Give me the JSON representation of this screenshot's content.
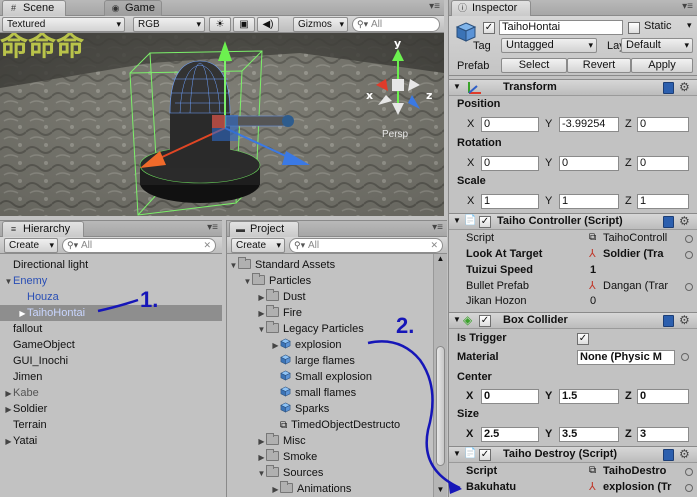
{
  "scene": {
    "tab_scene": "Scene",
    "tab_game": "Game",
    "draw_mode": "Textured",
    "color_mode": "RGB",
    "gizmos": "Gizmos",
    "search_placeholder": "All",
    "persp_label": "Persp",
    "axis_x": "x",
    "axis_y": "y",
    "axis_z": "z",
    "overlay_text": "命命命"
  },
  "hierarchy": {
    "title": "Hierarchy",
    "create": "Create",
    "search_placeholder": "All",
    "items": [
      {
        "label": "Directional light",
        "indent": 0,
        "arrow": "",
        "style": "normal"
      },
      {
        "label": "Enemy",
        "indent": 0,
        "arrow": "▼",
        "style": "blue"
      },
      {
        "label": "Houza",
        "indent": 1,
        "arrow": "",
        "style": "blue"
      },
      {
        "label": "TaihoHontai",
        "indent": 1,
        "arrow": "▶",
        "style": "selected"
      },
      {
        "label": "fallout",
        "indent": 0,
        "arrow": "",
        "style": "normal"
      },
      {
        "label": "GameObject",
        "indent": 0,
        "arrow": "",
        "style": "normal"
      },
      {
        "label": "GUI_Inochi",
        "indent": 0,
        "arrow": "",
        "style": "normal"
      },
      {
        "label": "Jimen",
        "indent": 0,
        "arrow": "",
        "style": "normal"
      },
      {
        "label": "Kabe",
        "indent": 0,
        "arrow": "▶",
        "style": "gray"
      },
      {
        "label": "Soldier",
        "indent": 0,
        "arrow": "▶",
        "style": "normal"
      },
      {
        "label": "Terrain",
        "indent": 0,
        "arrow": "",
        "style": "normal"
      },
      {
        "label": "Yatai",
        "indent": 0,
        "arrow": "▶",
        "style": "normal"
      }
    ]
  },
  "project": {
    "title": "Project",
    "create": "Create",
    "search_placeholder": "All",
    "items": [
      {
        "label": "Standard Assets",
        "indent": 0,
        "arrow": "▼",
        "icon": "folder"
      },
      {
        "label": "Particles",
        "indent": 1,
        "arrow": "▼",
        "icon": "folder"
      },
      {
        "label": "Dust",
        "indent": 2,
        "arrow": "▶",
        "icon": "folder"
      },
      {
        "label": "Fire",
        "indent": 2,
        "arrow": "▶",
        "icon": "folder"
      },
      {
        "label": "Legacy Particles",
        "indent": 2,
        "arrow": "▼",
        "icon": "folder"
      },
      {
        "label": "explosion",
        "indent": 3,
        "arrow": "▶",
        "icon": "prefab"
      },
      {
        "label": "large flames",
        "indent": 3,
        "arrow": "",
        "icon": "prefab"
      },
      {
        "label": "Small explosion",
        "indent": 3,
        "arrow": "",
        "icon": "prefab"
      },
      {
        "label": "small flames",
        "indent": 3,
        "arrow": "",
        "icon": "prefab"
      },
      {
        "label": "Sparks",
        "indent": 3,
        "arrow": "",
        "icon": "prefab"
      },
      {
        "label": "TimedObjectDestructo",
        "indent": 3,
        "arrow": "",
        "icon": "script"
      },
      {
        "label": "Misc",
        "indent": 2,
        "arrow": "▶",
        "icon": "folder"
      },
      {
        "label": "Smoke",
        "indent": 2,
        "arrow": "▶",
        "icon": "folder"
      },
      {
        "label": "Sources",
        "indent": 2,
        "arrow": "▼",
        "icon": "folder"
      },
      {
        "label": "Animations",
        "indent": 3,
        "arrow": "▶",
        "icon": "folder"
      }
    ]
  },
  "inspector": {
    "title": "Inspector",
    "object_name": "TaihoHontai",
    "static_label": "Static",
    "tag_label": "Tag",
    "tag_value": "Untagged",
    "layer_label": "Layer",
    "layer_value": "Default",
    "prefab_label": "Prefab",
    "prefab_select": "Select",
    "prefab_revert": "Revert",
    "prefab_apply": "Apply",
    "transform": {
      "title": "Transform",
      "position_label": "Position",
      "rotation_label": "Rotation",
      "scale_label": "Scale",
      "x": "X",
      "y": "Y",
      "z": "Z",
      "position": [
        "0",
        "-3.99254",
        "0"
      ],
      "rotation": [
        "0",
        "0",
        "0"
      ],
      "scale": [
        "1",
        "1",
        "1"
      ]
    },
    "taiho_controller": {
      "title": "Taiho Controller (Script)",
      "script_label": "Script",
      "script_value": "TaihoControll",
      "look_label": "Look At Target",
      "look_value": "Soldier (Tra",
      "speed_label": "Tuizui Speed",
      "speed_value": "1",
      "bullet_label": "Bullet Prefab",
      "bullet_value": "Dangan (Trar",
      "jikan_label": "Jikan Hozon",
      "jikan_value": "0"
    },
    "box_collider": {
      "title": "Box Collider",
      "trigger_label": "Is Trigger",
      "material_label": "Material",
      "material_value": "None (Physic M",
      "center_label": "Center",
      "center": [
        "0",
        "1.5",
        "0"
      ],
      "size_label": "Size",
      "size": [
        "2.5",
        "3.5",
        "3"
      ],
      "x": "X",
      "y": "Y",
      "z": "Z"
    },
    "taiho_destroy": {
      "title": "Taiho Destroy (Script)",
      "script_label": "Script",
      "script_value": "TaihoDestro",
      "bakuhatu_label": "Bakuhatu",
      "bakuhatu_value": "explosion (Tr"
    }
  },
  "annotations": {
    "step1": "1.",
    "step2": "2.",
    "color": "#1616b8"
  }
}
